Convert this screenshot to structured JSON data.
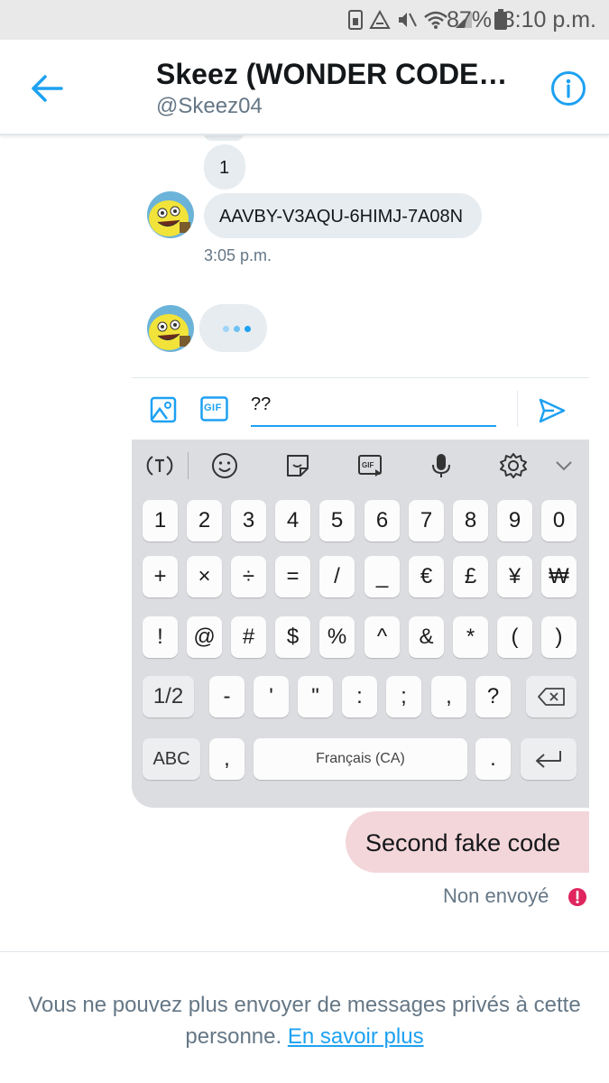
{
  "status_bar": {
    "battery_percent": "87%",
    "time": "3:10 p.m."
  },
  "header": {
    "title": "Skeez (WONDER CODE…",
    "handle": "@Skeez04",
    "accent_color": "#1da1f2"
  },
  "conversation": {
    "messages": [
      {
        "text": "1"
      },
      {
        "text": "AAVBY-V3AQU-6HIMJ-7A08N"
      }
    ],
    "timestamp": "3:05 p.m.",
    "typing_indicator": true
  },
  "composer": {
    "input_value": "??",
    "gif_label": "GIF"
  },
  "keyboard": {
    "toolbar_gif_label": "GIF",
    "rows": [
      [
        "1",
        "2",
        "3",
        "4",
        "5",
        "6",
        "7",
        "8",
        "9",
        "0"
      ],
      [
        "+",
        "×",
        "÷",
        "=",
        "/",
        "_",
        "€",
        "£",
        "¥",
        "₩"
      ],
      [
        "!",
        "@",
        "#",
        "$",
        "%",
        "^",
        "&",
        "*",
        "(",
        ")"
      ],
      [
        "-",
        "'",
        "\"",
        ":",
        ";",
        ",",
        "?"
      ]
    ],
    "page_key": "1/2",
    "abc_key": "ABC",
    "comma_key": ",",
    "space_label": "Français (CA)",
    "period_key": "."
  },
  "sent_message": {
    "text": "Second fake code",
    "status": "Non envoyé",
    "bubble_color": "#f3d6d9",
    "error_color": "#e0245e"
  },
  "footer": {
    "notice": "Vous ne pouvez plus envoyer de messages privés à cette personne.",
    "link_text": "En savoir plus"
  }
}
